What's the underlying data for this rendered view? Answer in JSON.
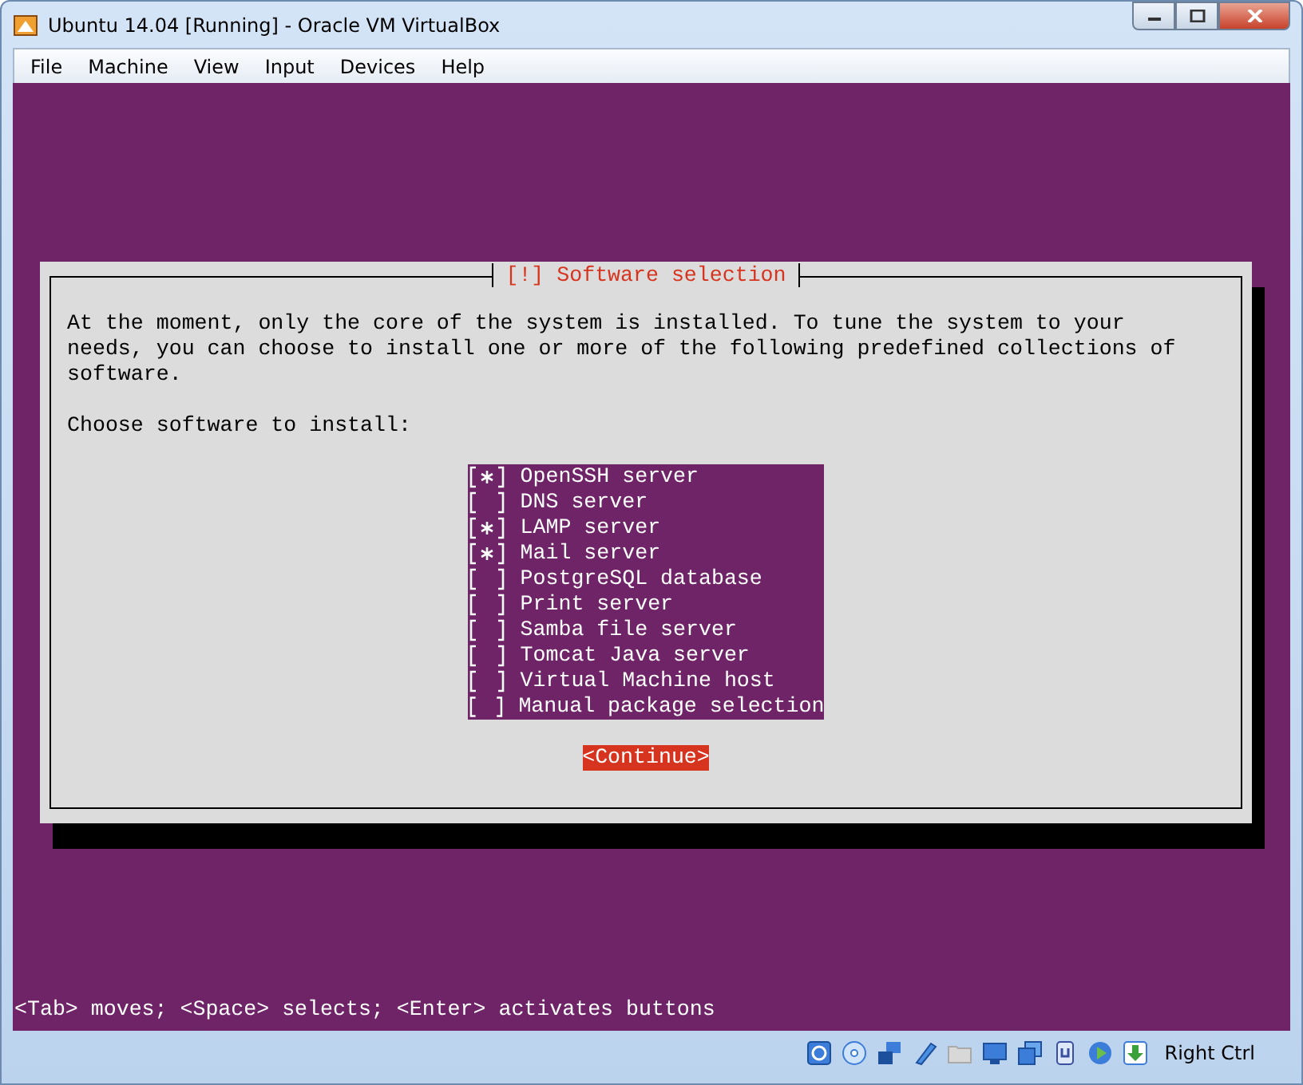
{
  "window": {
    "title": "Ubuntu 14.04 [Running] - Oracle VM VirtualBox"
  },
  "menu": [
    "File",
    "Machine",
    "View",
    "Input",
    "Devices",
    "Help"
  ],
  "dialog": {
    "title": "[!] Software selection",
    "intro": "At the moment, only the core of the system is installed. To tune the system to your needs, you can choose to install one or more of the following predefined collections of software.",
    "prompt": "Choose software to install:",
    "options": [
      {
        "label": "OpenSSH server",
        "checked": true
      },
      {
        "label": "DNS server",
        "checked": false
      },
      {
        "label": "LAMP server",
        "checked": true
      },
      {
        "label": "Mail server",
        "checked": true
      },
      {
        "label": "PostgreSQL database",
        "checked": false
      },
      {
        "label": "Print server",
        "checked": false
      },
      {
        "label": "Samba file server",
        "checked": false
      },
      {
        "label": "Tomcat Java server",
        "checked": false
      },
      {
        "label": "Virtual Machine host",
        "checked": false
      },
      {
        "label": "Manual package selection",
        "checked": false
      }
    ],
    "button": "<Continue>"
  },
  "console_hint": "<Tab> moves; <Space> selects; <Enter> activates buttons",
  "status_bar": {
    "host_key": "Right Ctrl"
  }
}
